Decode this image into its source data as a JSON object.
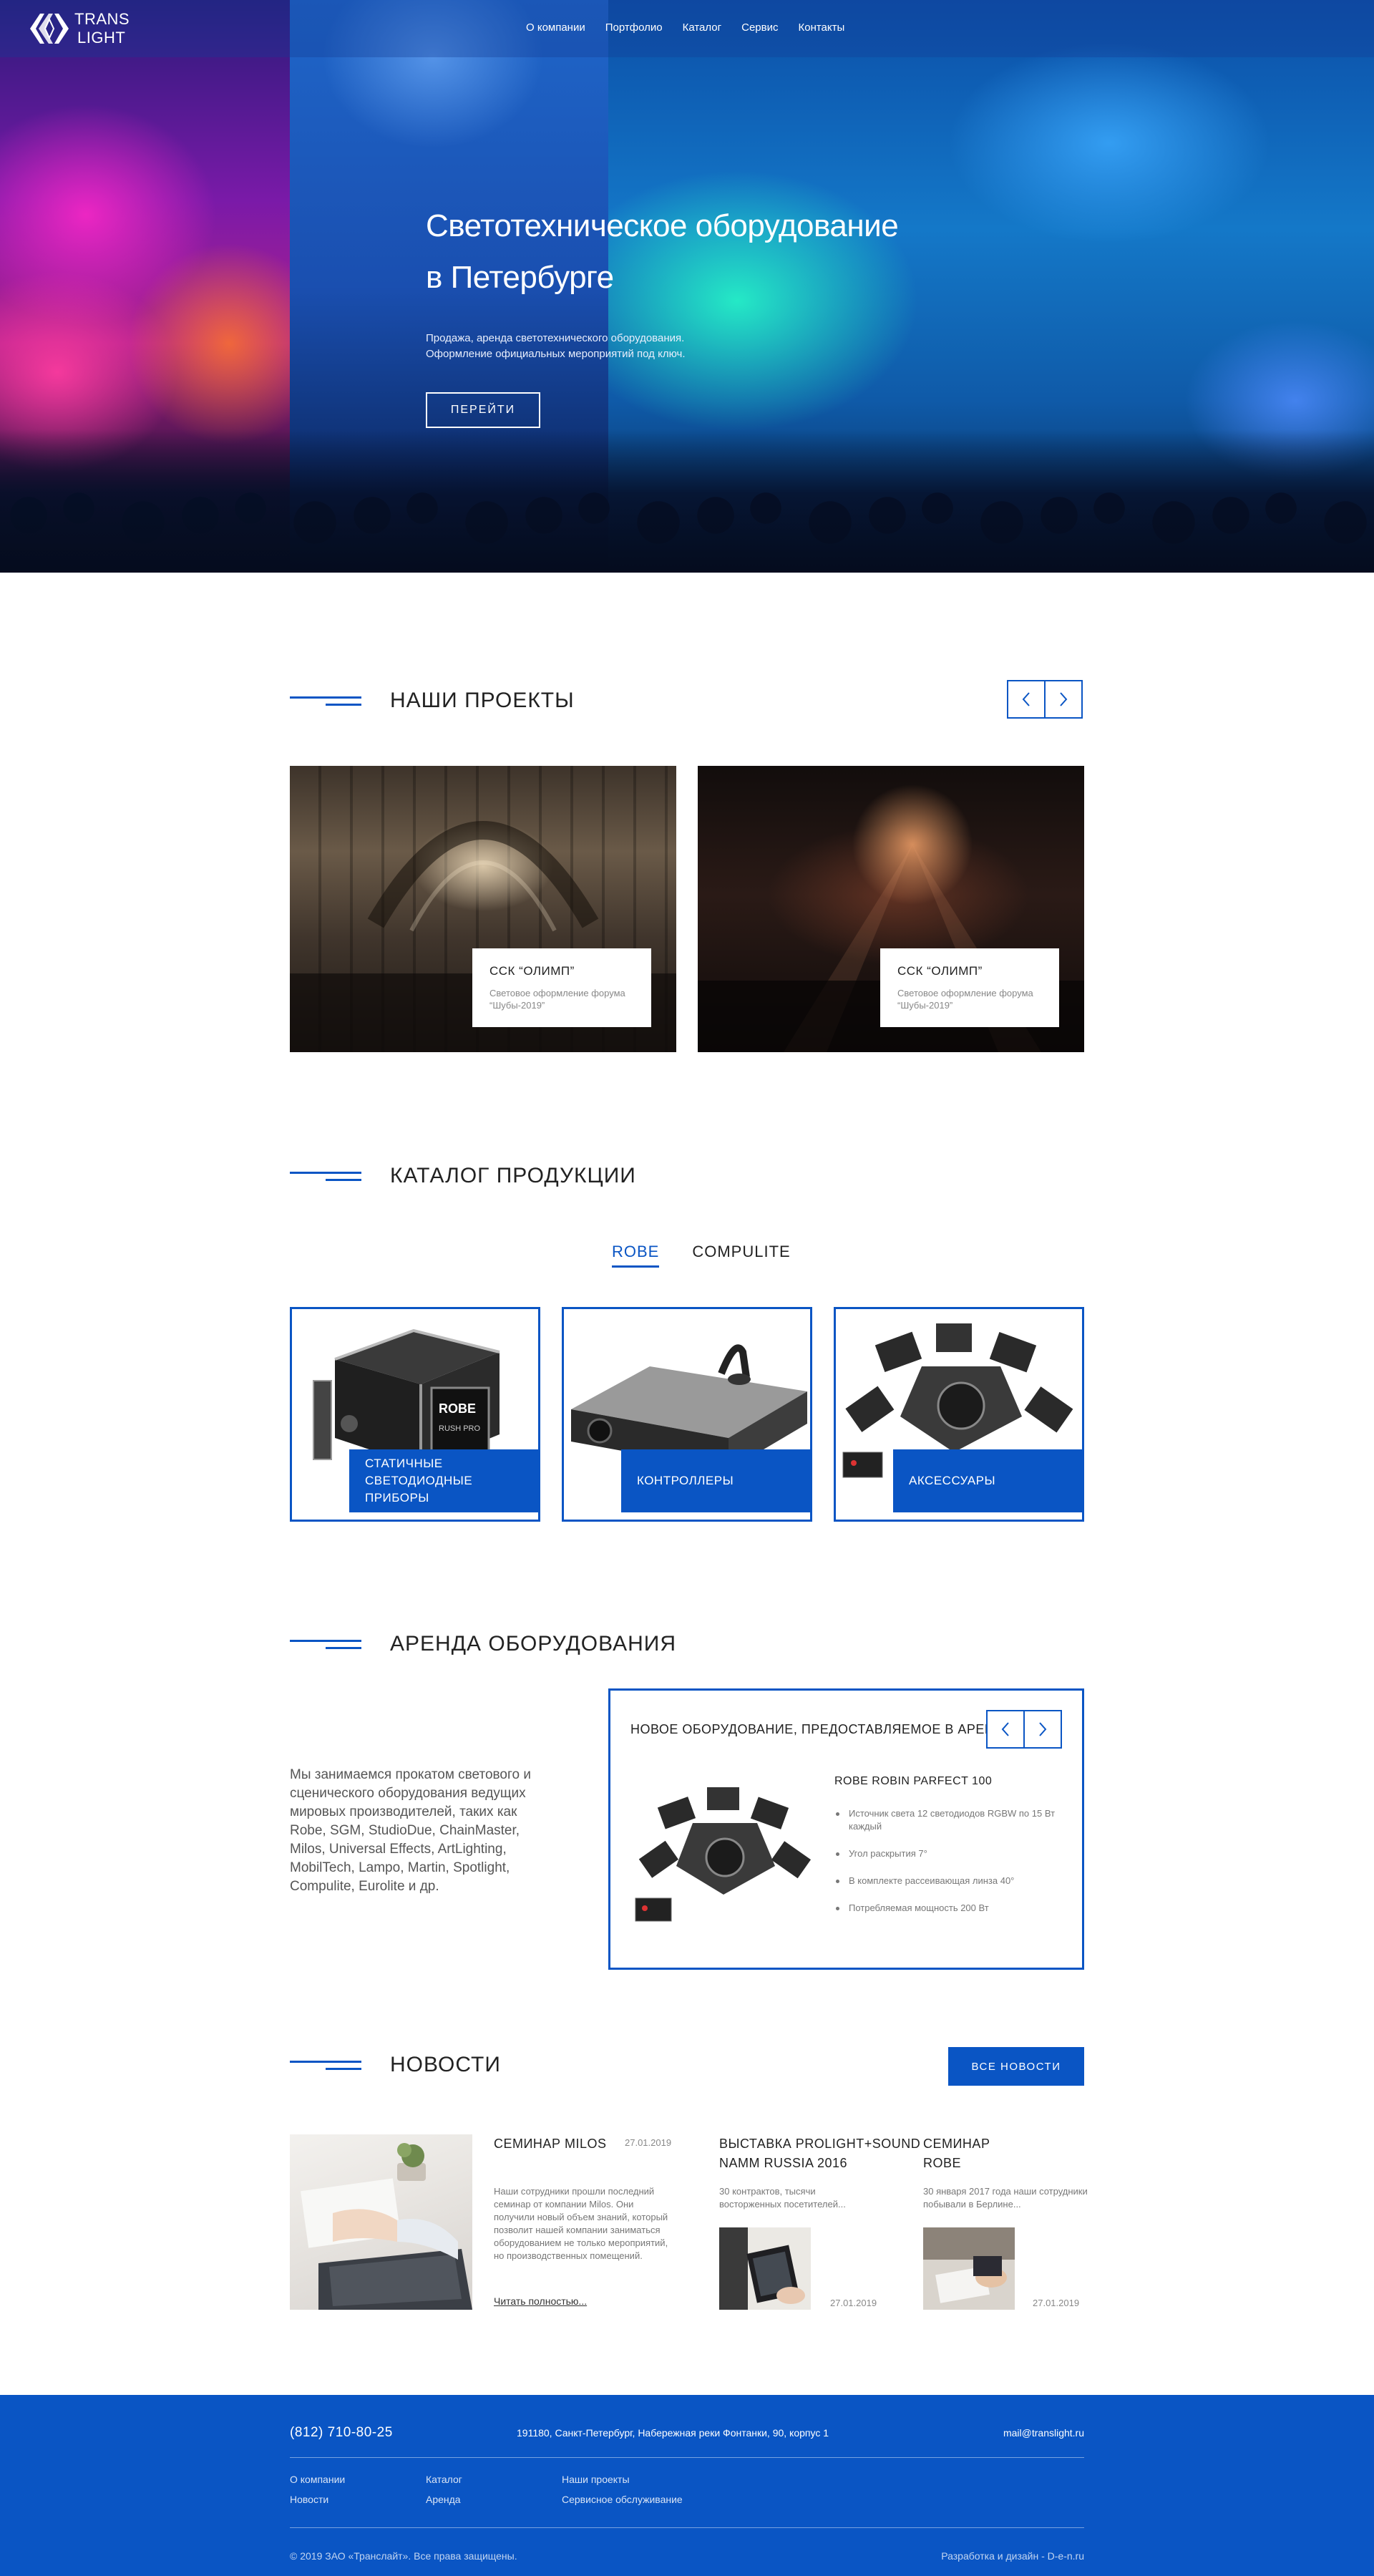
{
  "brand": {
    "line1": "TRANS",
    "line2": "LIGHT"
  },
  "nav": [
    {
      "label": "О компании"
    },
    {
      "label": "Портфолио"
    },
    {
      "label": "Каталог"
    },
    {
      "label": "Сервис"
    },
    {
      "label": "Контакты"
    }
  ],
  "hero": {
    "title_line1": "Светотехническое оборудование",
    "title_line2": "в Петербурге",
    "subtitle_line1": "Продажа, аренда светотехнического оборудования.",
    "subtitle_line2": "Оформление официальных мероприятий под ключ.",
    "button": "ПЕРЕЙТИ"
  },
  "projects": {
    "title": "НАШИ ПРОЕКТЫ",
    "items": [
      {
        "name": "ССК “ОЛИМП”",
        "desc": "Световое оформление форума “Шубы-2019”"
      },
      {
        "name": "ССК “ОЛИМП”",
        "desc": "Световое оформление форума “Шубы-2019”"
      }
    ]
  },
  "catalog": {
    "title": "КАТАЛОГ ПРОДУКЦИИ",
    "tabs": [
      {
        "label": "ROBE",
        "active": true
      },
      {
        "label": "COMPULITE",
        "active": false
      }
    ],
    "items": [
      {
        "label": "СТАТИЧНЫЕ\nСВЕТОДИОДНЫЕ ПРИБОРЫ"
      },
      {
        "label": "КОНТРОЛЛЕРЫ"
      },
      {
        "label": "АКСЕССУАРЫ"
      }
    ],
    "case_brand": "ROBE",
    "case_model": "RUSH PRO"
  },
  "rent": {
    "title": "АРЕНДА ОБОРУДОВАНИЯ",
    "text": "Мы занимаемся прокатом светового и сценического оборудования ведущих мировых производителей, таких как Robe, SGM, StudioDue, ChainMaster, Milos, Universal Effects, ArtLighting, MobilTech, Lampo, Martin, Spotlight, Compulite, Eurolite и др.",
    "box_title": "НОВОЕ ОБОРУДОВАНИЕ, ПРЕДОСТАВЛЯЕМОЕ В АРЕНДУ:",
    "product_name": "ROBE ROBIN PARFECT 100",
    "features": [
      "Источник света 12 светодиодов RGBW по 15 Вт каждый",
      "Угол раскрытия 7°",
      "В комплекте рассеивающая линза 40°",
      "Потребляемая мощность 200 Вт"
    ]
  },
  "news": {
    "title": "НОВОСТИ",
    "all_button": "ВСЕ НОВОСТИ",
    "main": {
      "title": "СЕМИНАР MILOS",
      "date": "27.01.2019",
      "text": "Наши сотрудники прошли последний семинар от компании Milos. Они получили новый объем знаний, который позволит нашей компании заниматься оборудованием не только мероприятий, но производственных помещений.",
      "more": "Читать полностью..."
    },
    "second": {
      "title_line1": "ВЫСТАВКА PROLIGHT+SOUND",
      "title_line2": "NAMM RUSSIA 2016",
      "text": "30 контрактов, тысячи восторженных посетителей...",
      "date": "27.01.2019"
    },
    "third": {
      "title_line1": "СЕМИНАР",
      "title_line2": "ROBE",
      "text": "30 января 2017 года наши сотрудники побывали в Берлине...",
      "date": "27.01.2019"
    }
  },
  "footer": {
    "phone": "(812) 710-80-25",
    "address": "191180, Санкт-Петербург, Набережная реки Фонтанки, 90, корпус 1",
    "email": "mail@translight.ru",
    "links": [
      {
        "label": "О компании"
      },
      {
        "label": "Новости"
      },
      {
        "label": "Каталог"
      },
      {
        "label": "Аренда"
      },
      {
        "label": "Наши проекты"
      },
      {
        "label": "Сервисное обслуживание"
      }
    ],
    "copyright": "© 2019 ЗАО «Транслайт». Все права защищены.",
    "developer": "Разработка и дизайн - D-e-n.ru"
  }
}
